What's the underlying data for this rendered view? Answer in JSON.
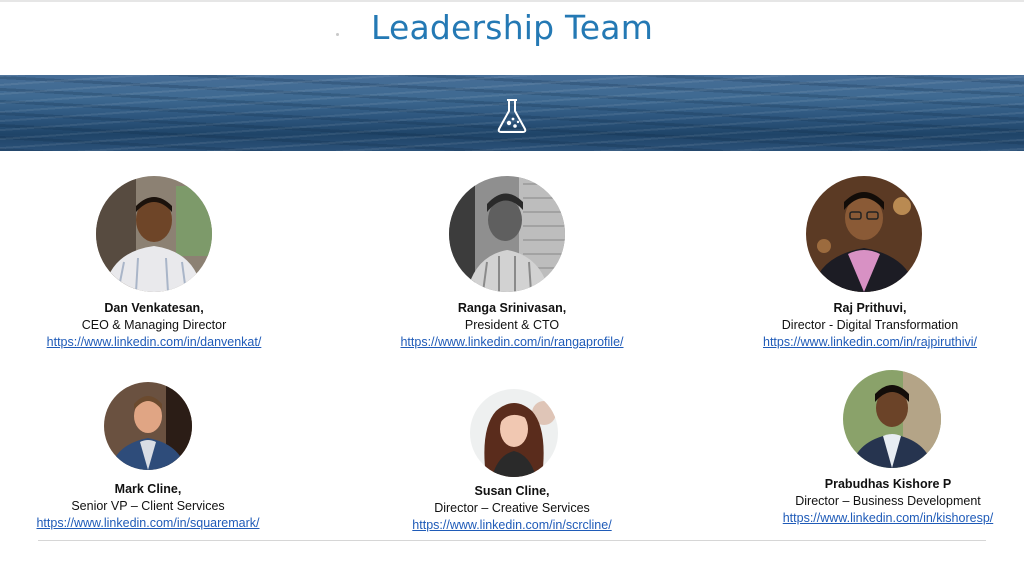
{
  "page": {
    "title": "Leadership Team"
  },
  "banner": {
    "icon": "flask-icon"
  },
  "team": [
    {
      "name": "Dan Venkatesan,",
      "role": "CEO & Managing Director",
      "link": "https://www.linkedin.com/in/danvenkat/"
    },
    {
      "name": "Ranga Srinivasan,",
      "role": "President & CTO",
      "link": "https://www.linkedin.com/in/rangaprofile/"
    },
    {
      "name": "Raj Prithuvi,",
      "role": "Director - Digital Transformation",
      "link": "https://www.linkedin.com/in/rajpiruthivi/"
    },
    {
      "name": "Mark Cline,",
      "role": "Senior VP – Client Services",
      "link": "https://www.linkedin.com/in/squaremark/"
    },
    {
      "name": "Susan Cline,",
      "role": "Director – Creative Services",
      "link": "https://www.linkedin.com/in/scrcline/"
    },
    {
      "name": "Prabudhas Kishore P",
      "role": "Director – Business Development",
      "link": "https://www.linkedin.com/in/kishoresp/"
    }
  ]
}
